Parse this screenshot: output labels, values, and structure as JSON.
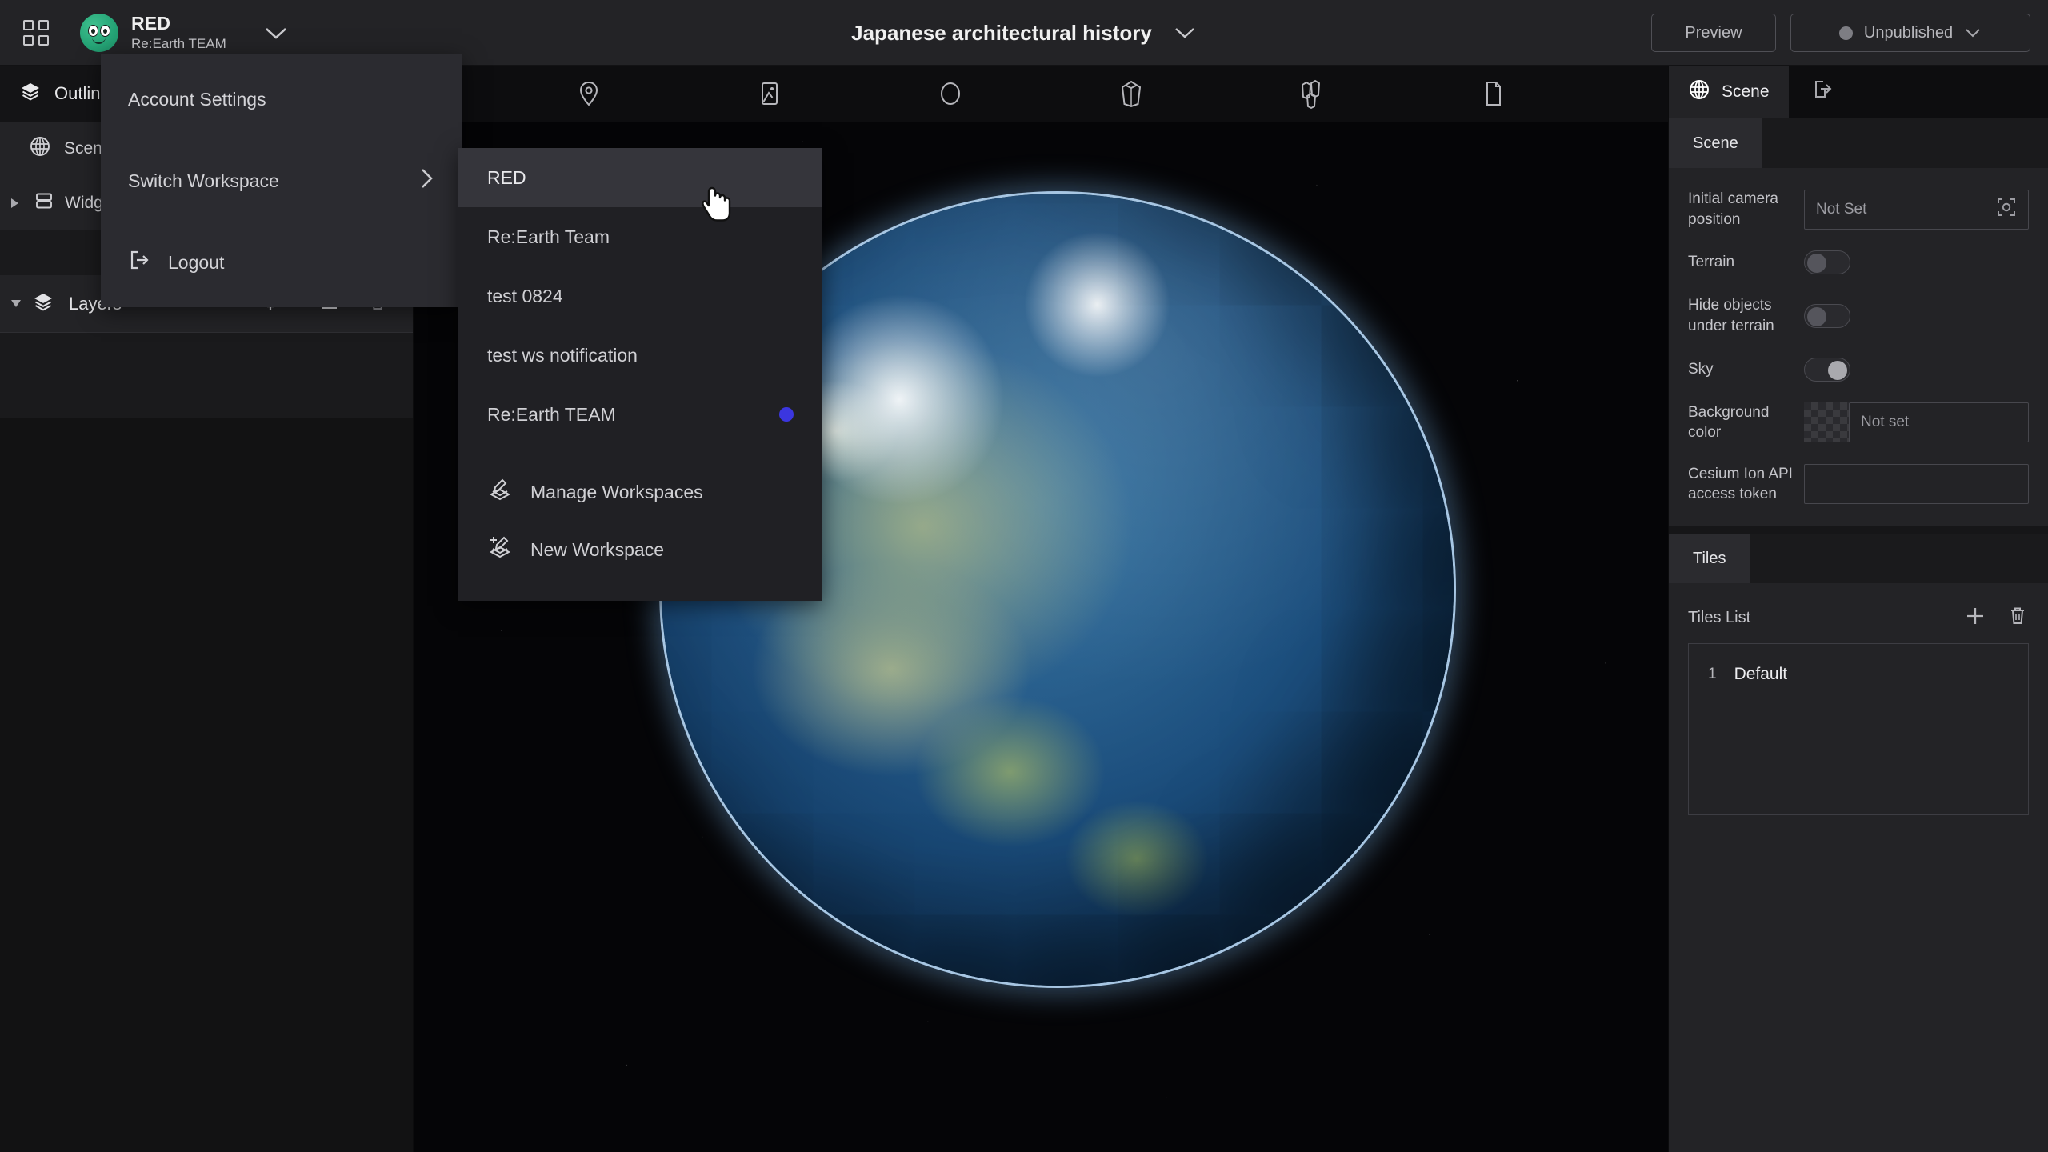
{
  "header": {
    "apps_icon": "grid-apps-icon",
    "account": {
      "name": "RED",
      "workspace": "Re:Earth TEAM",
      "avatar_icon": "user-avatar-icon",
      "chevron_icon": "chevron-down-icon"
    },
    "project_title": "Japanese architectural history",
    "title_chevron_icon": "chevron-down-icon",
    "preview_label": "Preview",
    "publish_status": "Unpublished",
    "publish_dot_color": "#7d7d83",
    "publish_chevron_icon": "chevron-down-icon"
  },
  "account_menu": {
    "items": [
      {
        "label": "Account Settings",
        "icon": null,
        "has_submenu": false
      },
      {
        "label": "Switch Workspace",
        "icon": null,
        "has_submenu": true,
        "submenu_icon": "chevron-right-icon"
      },
      {
        "label": "Logout",
        "icon": "logout-icon",
        "has_submenu": false
      }
    ]
  },
  "workspace_menu": {
    "workspaces": [
      {
        "label": "RED",
        "active": true,
        "current": false
      },
      {
        "label": "Re:Earth Team",
        "active": false,
        "current": false
      },
      {
        "label": "test 0824",
        "active": false,
        "current": false
      },
      {
        "label": "test ws notification",
        "active": false,
        "current": false
      },
      {
        "label": "Re:Earth TEAM",
        "active": false,
        "current": true
      }
    ],
    "current_dot_color": "#3b36e0",
    "actions": [
      {
        "label": "Manage Workspaces",
        "icon": "manage-workspaces-icon"
      },
      {
        "label": "New Workspace",
        "icon": "new-workspace-icon"
      }
    ]
  },
  "sidebar": {
    "outline_tab": {
      "label": "Outline",
      "icon": "layers-stack-icon"
    },
    "items": [
      {
        "label": "Scene",
        "icon": "globe-icon"
      },
      {
        "label": "Widgets",
        "icon": "widgets-icon",
        "expander_icon": "triangle-right-icon"
      }
    ],
    "layers": {
      "label": "Layers",
      "icon": "layers-stack-icon",
      "expander_icon": "triangle-down-icon",
      "actions": [
        {
          "icon": "add-layer-icon"
        },
        {
          "icon": "add-folder-icon"
        },
        {
          "icon": "trash-icon"
        }
      ]
    }
  },
  "canvas": {
    "toolbar_icons": [
      "map-pin-icon",
      "photo-overlay-icon",
      "sphere-icon",
      "box-3d-icon",
      "models-3d-icon",
      "page-icon"
    ],
    "annotation_color": "#e8c215",
    "cursor_icon": "pointing-hand-cursor"
  },
  "right_panel": {
    "tabs": [
      {
        "label": "Scene",
        "icon": "globe-icon",
        "active": true
      },
      {
        "label": "",
        "icon": "publish-export-icon",
        "active": false
      }
    ],
    "sub_tab": "Scene",
    "fields": [
      {
        "label": "Initial camera position",
        "type": "input",
        "value": "Not Set",
        "action_icon": "capture-camera-icon"
      },
      {
        "label": "Terrain",
        "type": "toggle",
        "value": "off"
      },
      {
        "label": "Hide objects under terrain",
        "type": "toggle",
        "value": "off"
      },
      {
        "label": "Sky",
        "type": "toggle",
        "value": "on"
      },
      {
        "label": "Background color",
        "type": "color",
        "value": "Not set",
        "swatch": "transparent-checker"
      },
      {
        "label": "Cesium Ion API access token",
        "type": "input",
        "value": ""
      }
    ],
    "tiles": {
      "tab_label": "Tiles",
      "list_label": "Tiles List",
      "actions": [
        {
          "icon": "plus-icon"
        },
        {
          "icon": "trash-icon"
        }
      ],
      "rows": [
        {
          "number": "1",
          "name": "Default"
        }
      ]
    }
  }
}
